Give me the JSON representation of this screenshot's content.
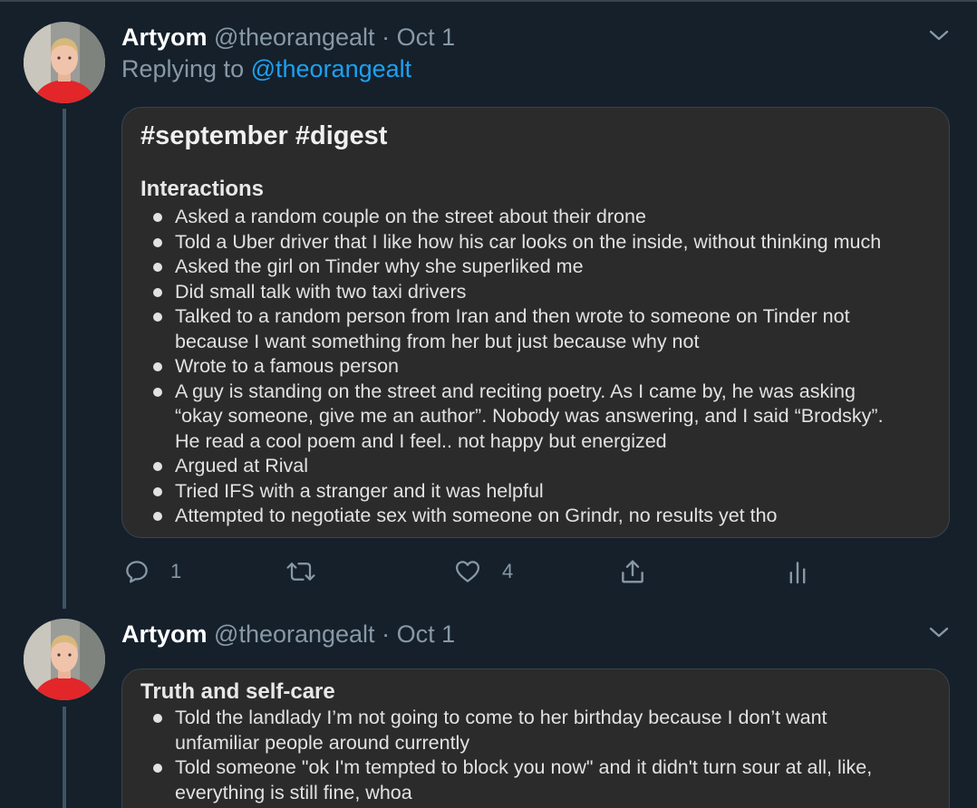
{
  "tweets": [
    {
      "author_name": "Artyom",
      "handle": "@theorangealt",
      "separator": "·",
      "date": "Oct 1",
      "replying_prefix": "Replying to",
      "replying_to": "@theorangealt",
      "note": {
        "title": "#september #digest",
        "heading": "Interactions",
        "items": [
          "Asked a random couple on the street about their drone",
          "Told a Uber driver that I like how his car looks on the inside, without thinking much",
          "Asked the girl on Tinder why she superliked me",
          "Did small talk with two taxi drivers",
          "Talked to a random person from Iran and then wrote to someone on Tinder not\nbecause I want something from her but just because why not",
          "Wrote to a famous person",
          "A guy is standing on the street and reciting poetry. As I came by, he was asking\n“okay someone, give me an author”. Nobody was answering, and I said “Brodsky”.\nHe read a cool poem and I feel.. not happy but energized",
          "Argued at Rival",
          "Tried IFS with a stranger and it was helpful",
          "Attempted to negotiate sex with someone on Grindr, no results yet tho"
        ]
      },
      "actions": {
        "reply_icon": "reply-icon",
        "reply_count": "1",
        "retweet_icon": "retweet-icon",
        "like_icon": "like-icon",
        "like_count": "4",
        "share_icon": "share-icon",
        "analytics_icon": "analytics-icon"
      }
    },
    {
      "author_name": "Artyom",
      "handle": "@theorangealt",
      "separator": "·",
      "date": "Oct 1",
      "note": {
        "heading": "Truth and self-care",
        "items": [
          "Told the landlady I’m not going to come to her birthday because I don’t want\nunfamiliar people around currently",
          "Told someone \"ok I'm tempted to block you now\" and it didn't turn sour at all, like,\neverything is still fine, whoa"
        ]
      }
    }
  ],
  "colors": {
    "background": "#15202b",
    "secondary_text": "#8899a6",
    "link": "#1da1f2",
    "thread_line": "#3d5466",
    "note_background": "#2b2b2b"
  }
}
